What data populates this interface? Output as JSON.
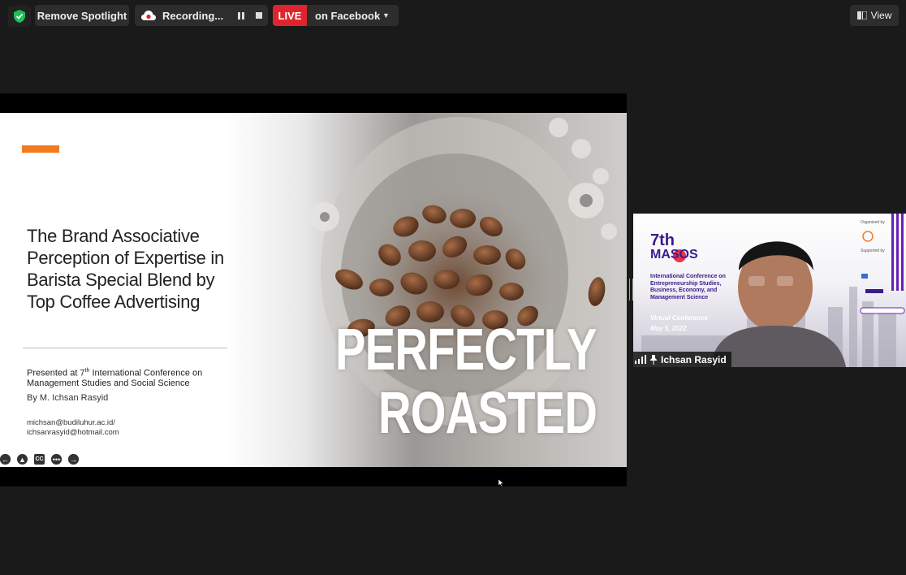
{
  "toolbar": {
    "spotlight_label": "Remove Spotlight",
    "recording_label": "Recording...",
    "live_badge": "LIVE",
    "live_target": "on Facebook",
    "view_label": "View"
  },
  "colors": {
    "accent_orange": "#f47a20",
    "live_red": "#e0242e",
    "shield_green": "#1fbf5a",
    "masos_purple": "#3a1b8c"
  },
  "slide": {
    "title": "The Brand Associative Perception of Expertise in Barista Special Blend by Top Coffee Advertising",
    "presented_prefix": "Presented at 7",
    "presented_sup": "th",
    "presented_suffix": " International Conference on Management Studies and Social Science",
    "author": "By M. Ichsan Rasyid",
    "email1": "michsan@budiluhur.ac.id/",
    "email2": "ichsanrasyid@hotmail.com",
    "big_text_1": "PERFECTLY",
    "big_text_2": "ROASTED",
    "controls": [
      "prev-icon",
      "pen-icon",
      "captions-icon",
      "more-icon",
      "next-icon"
    ],
    "cc_label": "CC"
  },
  "participant": {
    "name": "Ichsan Rasyid",
    "background": {
      "seventh": "7th",
      "masos": "MASOS",
      "description": "International Conference on Entrepreneurship Studies, Business, Economy, and Management Science",
      "virtual": "Virtual Conference",
      "date": "May 5, 2022",
      "organized": "Organized by",
      "supported": "Supported by"
    }
  }
}
